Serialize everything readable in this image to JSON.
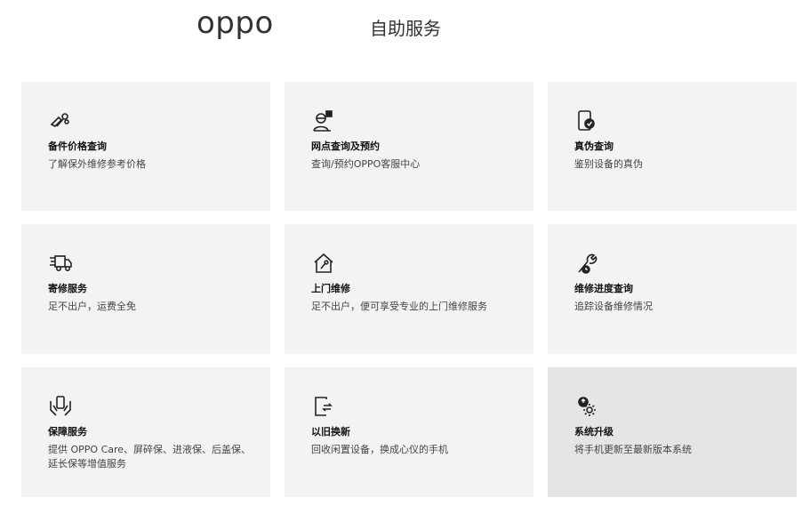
{
  "header": {
    "logo_text": "oppo",
    "title": "自助服务"
  },
  "cards": [
    {
      "title": "备件价格查询",
      "desc": "了解保外维修参考价格",
      "icon": "tools-icon"
    },
    {
      "title": "网点查询及预约",
      "desc": "查询/预约OPPO客服中心",
      "icon": "service-agent-icon"
    },
    {
      "title": "真伪查询",
      "desc": "鉴别设备的真伪",
      "icon": "phone-verify-icon"
    },
    {
      "title": "寄修服务",
      "desc": "足不出户，运费全免",
      "icon": "delivery-truck-icon"
    },
    {
      "title": "上门维修",
      "desc": "足不出户，便可享受专业的上门维修服务",
      "icon": "home-repair-icon"
    },
    {
      "title": "维修进度查询",
      "desc": "追踪设备维修情况",
      "icon": "wrench-progress-icon"
    },
    {
      "title": "保障服务",
      "desc": "提供 OPPO Care、屏碎保、进液保、后盖保、延长保等增值服务",
      "icon": "hands-protect-icon"
    },
    {
      "title": "以旧换新",
      "desc": "回收闲置设备，换成心仪的手机",
      "icon": "phone-exchange-icon"
    },
    {
      "title": "系统升级",
      "desc": "将手机更新至最新版本系统",
      "icon": "system-update-icon"
    }
  ]
}
